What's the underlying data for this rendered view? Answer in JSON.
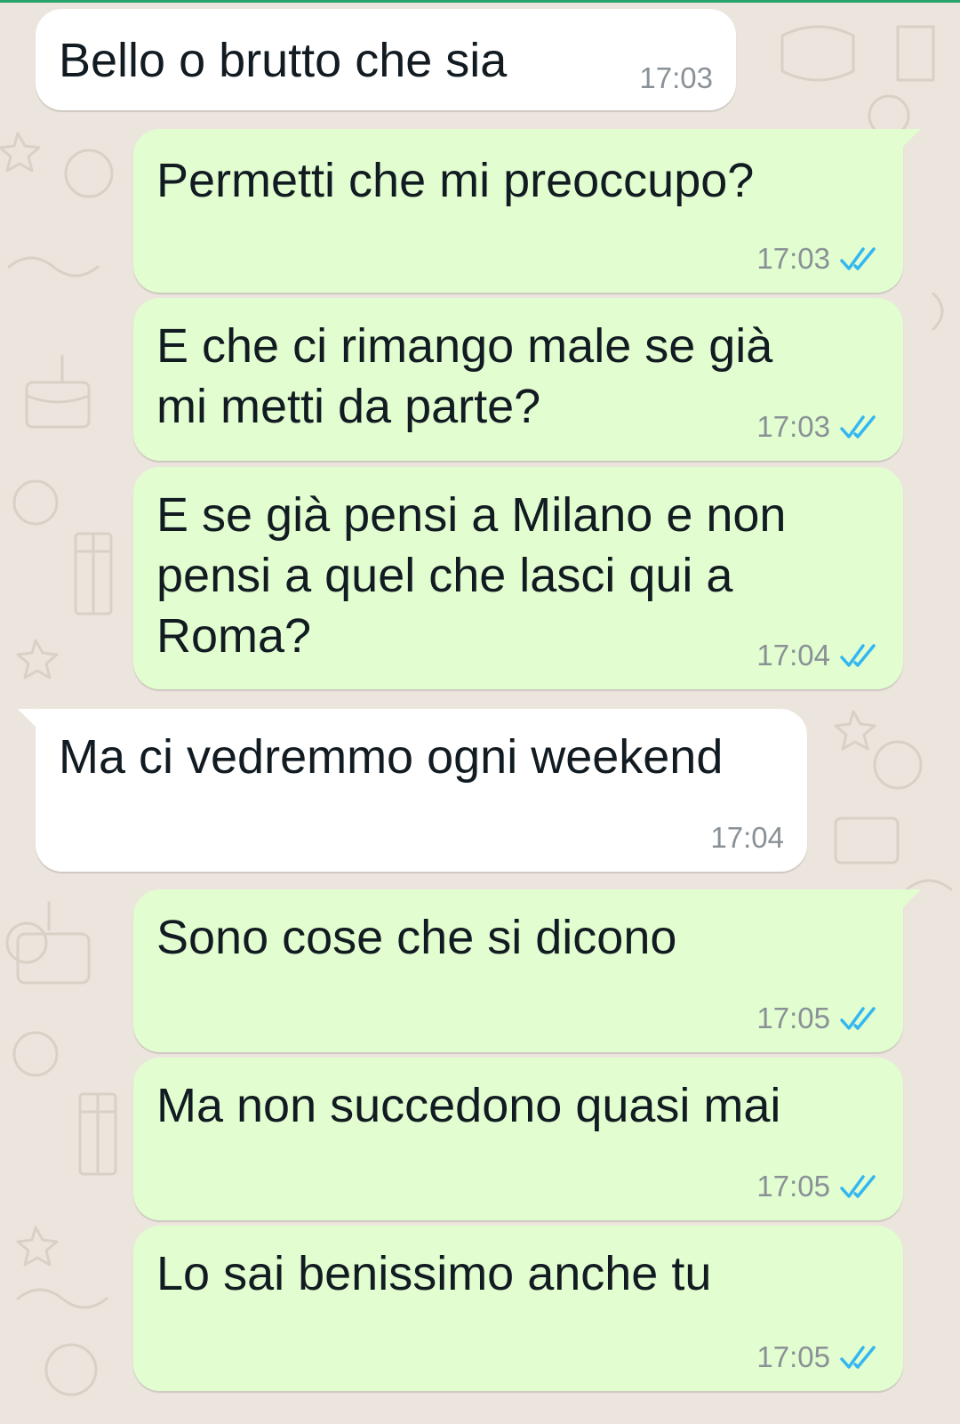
{
  "theme": {
    "incoming_bubble": "#ffffff",
    "outgoing_bubble": "#e2fdd0",
    "read_tick_color": "#34b7f1",
    "timestamp_color": "#8a9196",
    "text_color": "#111b21"
  },
  "messages": [
    {
      "direction": "incoming",
      "text": "Bello o brutto che sia",
      "time": "17:03",
      "status_icon": ""
    },
    {
      "direction": "outgoing",
      "text": "Permetti che mi preoccupo?",
      "time": "17:03",
      "status_icon": "double-check-read-icon"
    },
    {
      "direction": "outgoing",
      "text": "E che ci rimango male se già\nmi metti da parte?",
      "time": "17:03",
      "status_icon": "double-check-read-icon"
    },
    {
      "direction": "outgoing",
      "text": "E se già pensi a Milano e non\npensi a quel che lasci qui a\nRoma?",
      "time": "17:04",
      "status_icon": "double-check-read-icon"
    },
    {
      "direction": "incoming",
      "text": "Ma ci vedremmo ogni weekend",
      "time": "17:04",
      "status_icon": ""
    },
    {
      "direction": "outgoing",
      "text": "Sono cose che si dicono",
      "time": "17:05",
      "status_icon": "double-check-read-icon"
    },
    {
      "direction": "outgoing",
      "text": "Ma non succedono quasi mai",
      "time": "17:05",
      "status_icon": "double-check-read-icon"
    },
    {
      "direction": "outgoing",
      "text": "Lo sai benissimo anche tu",
      "time": "17:05",
      "status_icon": "double-check-read-icon"
    }
  ]
}
